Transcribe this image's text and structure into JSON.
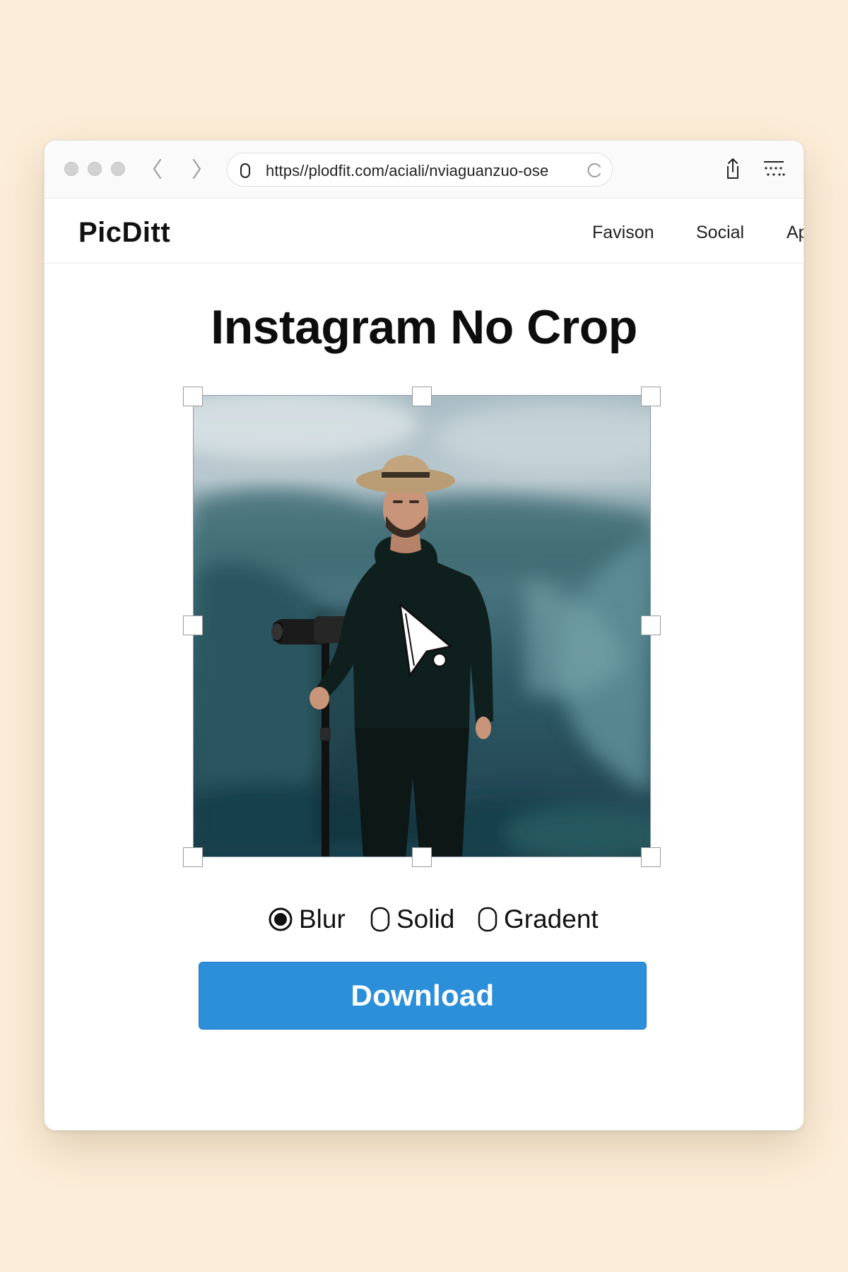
{
  "browser": {
    "url": "https//plodfit.com/aciali/nviaguanzuo-ose",
    "icons": {
      "back": "chevron-left-icon",
      "forward": "chevron-right-icon",
      "site": "shield-icon",
      "reload": "reload-icon",
      "share": "share-icon",
      "menu": "menu-icon"
    }
  },
  "site": {
    "logo": "PicDitt",
    "nav": [
      "Favison",
      "Social",
      "Ap"
    ]
  },
  "main": {
    "title": "Instagram No Crop",
    "image": {
      "subject": "man-with-hat-holding-camera-monopod",
      "background": "blurred-mountain-lake",
      "cursor": "arrow-cursor-icon"
    },
    "options": [
      {
        "label": "Blur",
        "selected": true
      },
      {
        "label": "Solid",
        "selected": false
      },
      {
        "label": "Gradent",
        "selected": false
      }
    ],
    "download_label": "Download"
  },
  "colors": {
    "background": "#fcedd8",
    "accent": "#2b8fd9"
  }
}
